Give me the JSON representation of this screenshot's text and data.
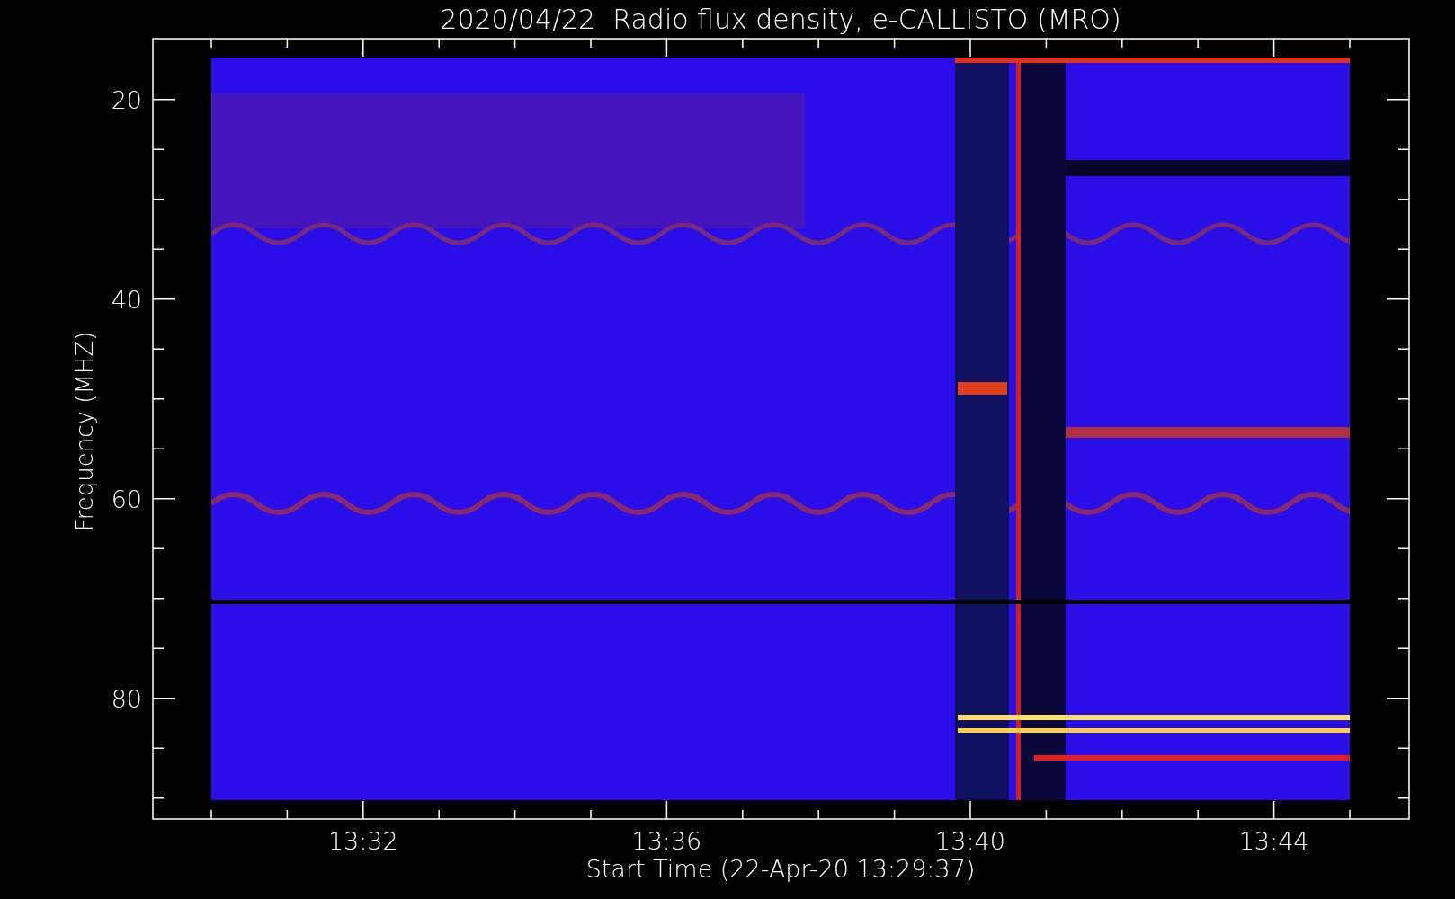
{
  "title": "2020/04/22  Radio flux density, e-CALLISTO (MRO)",
  "y_axis": {
    "label": "Frequency (MHZ)",
    "ticks": [
      "20",
      "40",
      "60",
      "80"
    ]
  },
  "x_axis": {
    "label": "Start Time (22-Apr-20 13:29:37)",
    "ticks": [
      "13:32",
      "13:36",
      "13:40",
      "13:44"
    ]
  }
}
